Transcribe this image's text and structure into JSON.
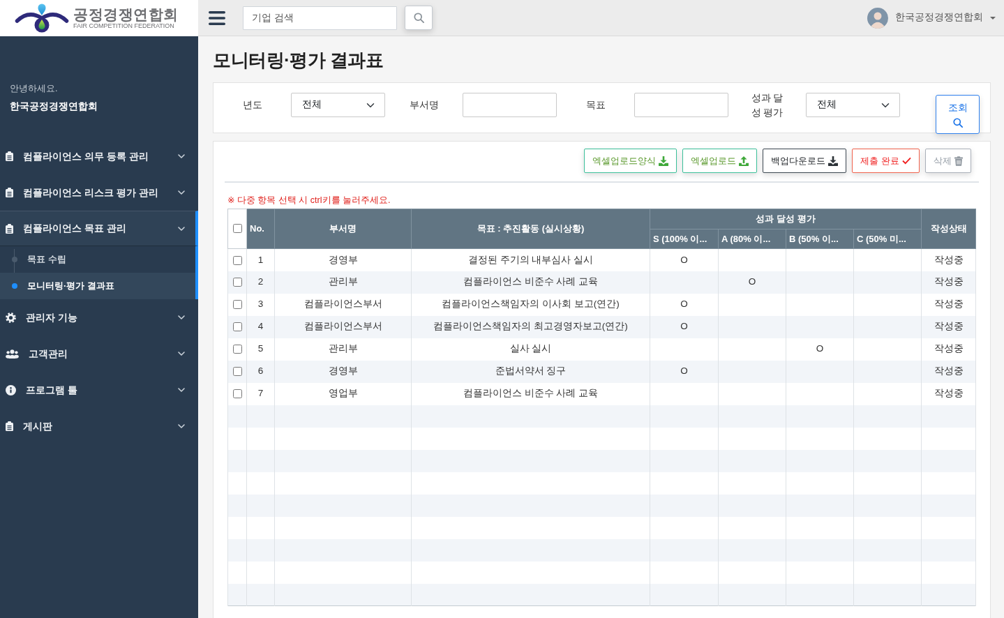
{
  "logo": {
    "name": "공정경쟁연합회",
    "subtitle": "FAIR COMPETITION FEDERATION"
  },
  "topbar": {
    "search": {
      "placeholder": "기업 검색"
    },
    "user": {
      "name": "한국공정경쟁연합회"
    }
  },
  "sidebar": {
    "greeting": "안녕하세요.",
    "user_name": "한국공정경쟁연합회",
    "items": [
      {
        "label": "컴플라이언스 의무 등록 관리",
        "expanded": false
      },
      {
        "label": "컴플라이언스 리스크 평가 관리",
        "expanded": false
      },
      {
        "label": "컴플라이언스 목표 관리",
        "expanded": true,
        "children": [
          {
            "label": "목표 수립",
            "selected": false
          },
          {
            "label": "모니터링·평가 결과표",
            "selected": true
          }
        ]
      },
      {
        "label": "관리자 기능",
        "expanded": false
      },
      {
        "label": "고객관리",
        "expanded": false
      },
      {
        "label": "프로그램 툴",
        "expanded": false
      },
      {
        "label": "게시판",
        "expanded": false
      }
    ]
  },
  "page": {
    "title": "모니터링·평가 결과표"
  },
  "filters": {
    "fields": [
      {
        "label": "년도",
        "kind": "select",
        "value": "전체"
      },
      {
        "label": "부서명",
        "kind": "text"
      },
      {
        "label": "목표",
        "kind": "text"
      },
      {
        "label": "성과 달성 평가",
        "kind": "select",
        "value": "전체"
      }
    ],
    "search_button": {
      "label": "조회"
    }
  },
  "toolbar": {
    "buttons": [
      {
        "label": "엑셀업로드양식",
        "kind": "template"
      },
      {
        "label": "엑셀업로드",
        "kind": "upload"
      },
      {
        "label": "백업다운로드",
        "kind": "backup"
      },
      {
        "label": "제출 완료",
        "kind": "submit"
      },
      {
        "label": "삭제",
        "kind": "delete"
      }
    ]
  },
  "note": "※ 다중 항목 선택 시 ctrl키를 눌러주세요.",
  "table": {
    "header_checkbox": {
      "checked": false
    },
    "columns": [
      {
        "label": "No."
      },
      {
        "label": "부서명"
      },
      {
        "label": "목표 : 추진활동 (실시상황)"
      },
      {
        "label": "성과 달성 평가",
        "subcolumns": [
          {
            "label": "S (100% 이..."
          },
          {
            "label": "A (80% 이..."
          },
          {
            "label": "B (50% 이..."
          },
          {
            "label": "C (50% 미..."
          }
        ]
      },
      {
        "label": "작성상태"
      }
    ],
    "rows": [
      {
        "checked": false,
        "no": "1",
        "department": "경영부",
        "activity": "결정된 주기의 내부심사 실시",
        "s": "O",
        "status": "작성중"
      },
      {
        "checked": false,
        "no": "2",
        "department": "관리부",
        "activity": "컴플라이언스 비준수 사례 교육",
        "a": "O",
        "status": "작성중"
      },
      {
        "checked": false,
        "no": "3",
        "department": "컴플라이언스부서",
        "activity": "컴플라이언스책임자의 이사회 보고(연간)",
        "s": "O",
        "status": "작성중"
      },
      {
        "checked": false,
        "no": "4",
        "department": "컴플라이언스부서",
        "activity": "컴플라이언스책임자의 최고경영자보고(연간)",
        "s": "O",
        "status": "작성중"
      },
      {
        "checked": false,
        "no": "5",
        "department": "관리부",
        "activity": "실사 실시",
        "b": "O",
        "status": "작성중"
      },
      {
        "checked": false,
        "no": "6",
        "department": "경영부",
        "activity": "준법서약서 징구",
        "s": "O",
        "status": "작성중"
      },
      {
        "checked": false,
        "no": "7",
        "department": "영업부",
        "activity": "컴플라이언스 비준수 사례 교육",
        "status": "작성중"
      }
    ]
  }
}
